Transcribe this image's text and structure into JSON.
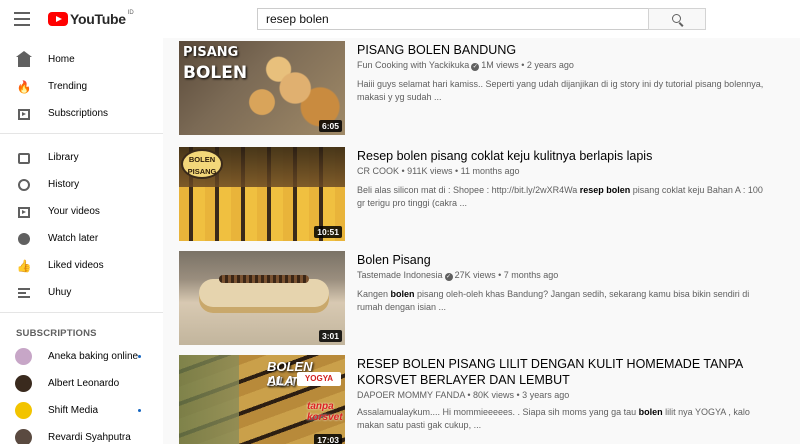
{
  "header": {
    "logo_text": "YouTube",
    "logo_country": "ID",
    "search_ghost": "Search",
    "search_value": "resep bolen"
  },
  "sidebar": {
    "main": [
      {
        "label": "Home",
        "icon": "home-icon"
      },
      {
        "label": "Trending",
        "icon": "trending-icon"
      },
      {
        "label": "Subscriptions",
        "icon": "subscriptions-icon"
      }
    ],
    "library": [
      {
        "label": "Library",
        "icon": "library-icon"
      },
      {
        "label": "History",
        "icon": "history-icon"
      },
      {
        "label": "Your videos",
        "icon": "your-videos-icon"
      },
      {
        "label": "Watch later",
        "icon": "watch-later-icon"
      },
      {
        "label": "Liked videos",
        "icon": "liked-videos-icon"
      },
      {
        "label": "Uhuy",
        "icon": "playlist-icon"
      }
    ],
    "subscriptions_title": "SUBSCRIPTIONS",
    "subscriptions": [
      {
        "label": "Aneka baking online",
        "dot": true,
        "color": "#c7a6c7"
      },
      {
        "label": "Albert Leonardo",
        "dot": false,
        "color": "#3a2a1e"
      },
      {
        "label": "Shift Media",
        "dot": true,
        "color": "#f2c400"
      },
      {
        "label": "Revardi Syahputra",
        "dot": false,
        "color": "#5a4a40"
      }
    ]
  },
  "results": [
    {
      "title": "PISANG BOLEN BANDUNG",
      "channel": "Fun Cooking with Yackikuka",
      "verified": true,
      "meta": "1M views • 2 years ago",
      "desc_plain": "Haiii guys selamat hari kamiss.. Seperti yang udah dijanjikan di ig story ini dy tutorial pisang bolennya, makasi y yg sudah ...",
      "duration": "6:05",
      "thumb_text1": "PISANG",
      "thumb_text2": "BOLEN"
    },
    {
      "title": "Resep bolen pisang coklat keju kulitnya berlapis lapis",
      "channel": "CR COOK",
      "verified": false,
      "meta": "911K views • 11 months ago",
      "desc_pre": "Beli alas silicon mat di : Shopee : http://bit.ly/2wXR4Wa ",
      "desc_bold": "resep bolen",
      "desc_post": " pisang coklat keju Bahan A : 100 gr terigu pro tinggi (cakra ...",
      "duration": "10:51",
      "thumb_text1": "BOLEN",
      "thumb_text2": "PISANG"
    },
    {
      "title": "Bolen Pisang",
      "channel": "Tastemade Indonesia",
      "verified": true,
      "meta": "27K views • 7 months ago",
      "desc_pre": "Kangen ",
      "desc_bold": "bolen",
      "desc_post": " pisang oleh-oleh khas Bandung? Jangan sedih, sekarang kamu bisa bikin sendiri di rumah dengan isian ...",
      "duration": "3:01"
    },
    {
      "title": "RESEP BOLEN PISANG LILIT DENGAN KULIT HOMEMADE TANPA KORSVET BERLAYER DAN LEMBUT",
      "channel": "DAPOER MOMMY FANDA",
      "verified": false,
      "meta": "80K views • 3 years ago",
      "desc_pre": "Assalamualaykum.... Hi mommieeeees. . Siapa sih moms yang ga tau ",
      "desc_bold": "bolen",
      "desc_post": " lilit nya YOGYA , kalo makan satu pasti gak cukup, ...",
      "duration": "17:03",
      "thumb_text1": "BOLEN LILIT",
      "thumb_text2": "ALA",
      "thumb_brand": "YOGYA",
      "thumb_text3": "tanpa korsvet"
    }
  ]
}
